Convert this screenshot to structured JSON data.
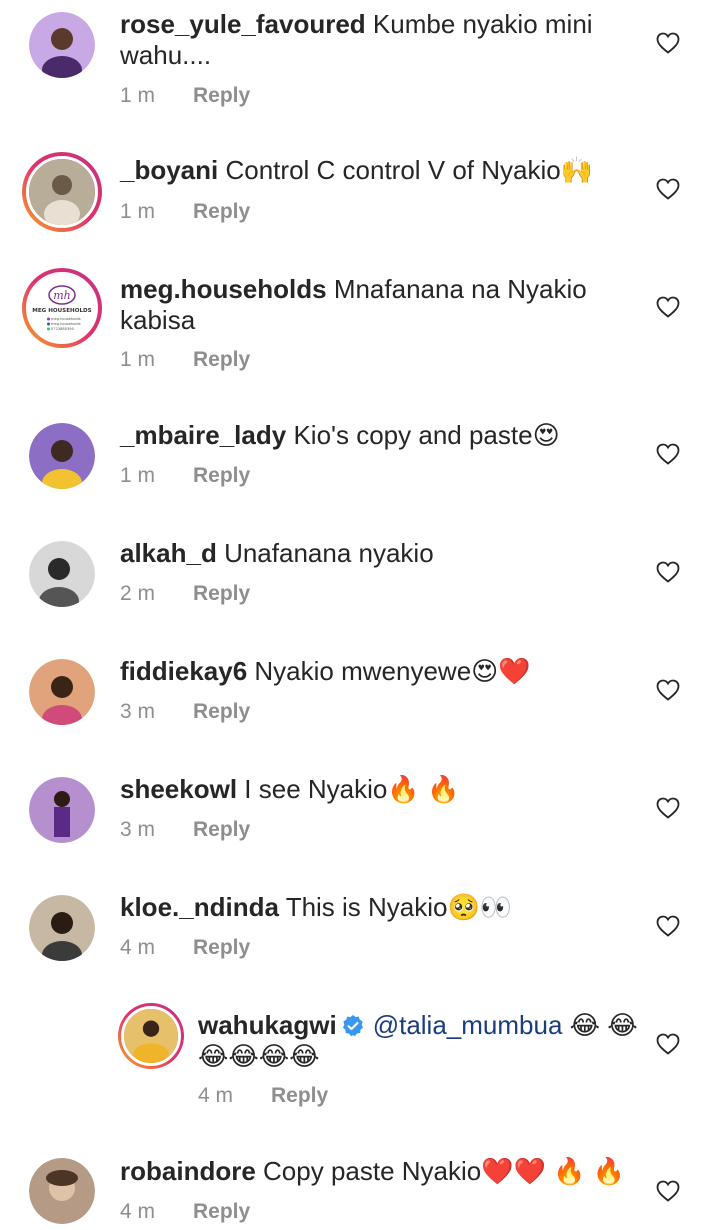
{
  "comments": [
    {
      "username": "rose_yule_favoured",
      "text": "Kumbe nyakio mini wahu....",
      "time": "1 m",
      "reply": "Reply",
      "avatar_color": "#b58ad9",
      "avatar_icon": "profile-photo"
    },
    {
      "username": "_boyani",
      "text": "Control C control V of Nyakio🙌",
      "time": "1 m",
      "reply": "Reply",
      "avatar_color": "#a89b86",
      "avatar_icon": "profile-photo"
    },
    {
      "username": "meg.households",
      "text": "Mnafanana na Nyakio kabisa",
      "time": "1 m",
      "reply": "Reply",
      "avatar_color": "#ffffff",
      "avatar_icon": "logo"
    },
    {
      "username": "_mbaire_lady",
      "text": "Kio's copy and paste😍",
      "time": "1 m",
      "reply": "Reply",
      "avatar_color": "#7a5bb0",
      "avatar_icon": "profile-photo"
    },
    {
      "username": "alkah_d",
      "text": "Unafanana nyakio",
      "time": "2 m",
      "reply": "Reply",
      "avatar_color": "#9a9a9a",
      "avatar_icon": "profile-photo"
    },
    {
      "username": "fiddiekay6",
      "text": "Nyakio mwenyewe😍❤️",
      "time": "3 m",
      "reply": "Reply",
      "avatar_color": "#c47a52",
      "avatar_icon": "profile-photo"
    },
    {
      "username": "sheekowl",
      "text": "I see Nyakio🔥 🔥",
      "time": "3 m",
      "reply": "Reply",
      "avatar_color": "#6d3f8f",
      "avatar_icon": "profile-photo"
    },
    {
      "username": "kloe._ndinda",
      "text": "This is Nyakio🥺👀",
      "time": "4 m",
      "reply": "Reply",
      "avatar_color": "#5c4a3d",
      "avatar_icon": "profile-photo"
    },
    {
      "username": "wahukagwi",
      "verified": true,
      "mention": "@talia_mumbua",
      "text": " 😂 😂😂😂😂😂",
      "time": "4 m",
      "reply": "Reply",
      "avatar_color": "#e8b53a",
      "avatar_icon": "profile-photo"
    },
    {
      "username": "robaindore",
      "text": "Copy paste Nyakio❤️❤️ 🔥 🔥",
      "time": "4 m",
      "reply": "Reply",
      "avatar_color": "#8a6f5a",
      "avatar_icon": "profile-photo"
    }
  ],
  "logo": {
    "monogram": "mh",
    "name": "MEG HOUSEHOLDS",
    "handle1": "meg.households",
    "handle2": "meg.households",
    "phone": "0723880390"
  },
  "colors": {
    "text": "#262626",
    "meta": "#8e8e8e",
    "mention": "#1a3d7c",
    "verified": "#3897f0"
  }
}
